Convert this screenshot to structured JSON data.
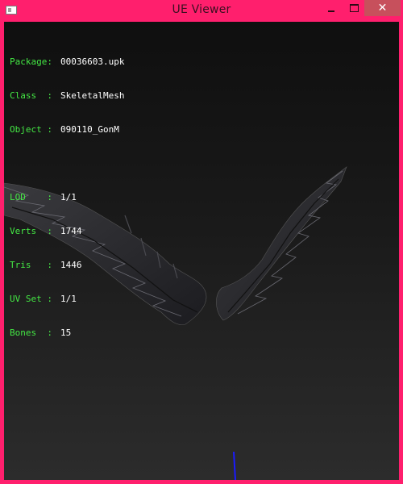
{
  "window": {
    "title": "UE Viewer",
    "controls": {
      "minimize": "—",
      "maximize": "☐",
      "close": "✕"
    }
  },
  "info": {
    "package": {
      "label": "Package:",
      "value": "00036603.upk"
    },
    "class": {
      "label": "Class  :",
      "value": "SkeletalMesh"
    },
    "object": {
      "label": "Object :",
      "value": "090110_GonM"
    },
    "lod": {
      "label": "LOD    :",
      "value": "1/1"
    },
    "verts": {
      "label": "Verts  :",
      "value": "1744"
    },
    "tris": {
      "label": "Tris   :",
      "value": "1446"
    },
    "uvset": {
      "label": "UV Set :",
      "value": "1/1"
    },
    "bones": {
      "label": "Bones  :",
      "value": "15"
    }
  },
  "colors": {
    "frame": "#ff1f6d",
    "label_green": "#44e844",
    "value_white": "#ffffff",
    "axis_blue": "#1a1aff"
  }
}
